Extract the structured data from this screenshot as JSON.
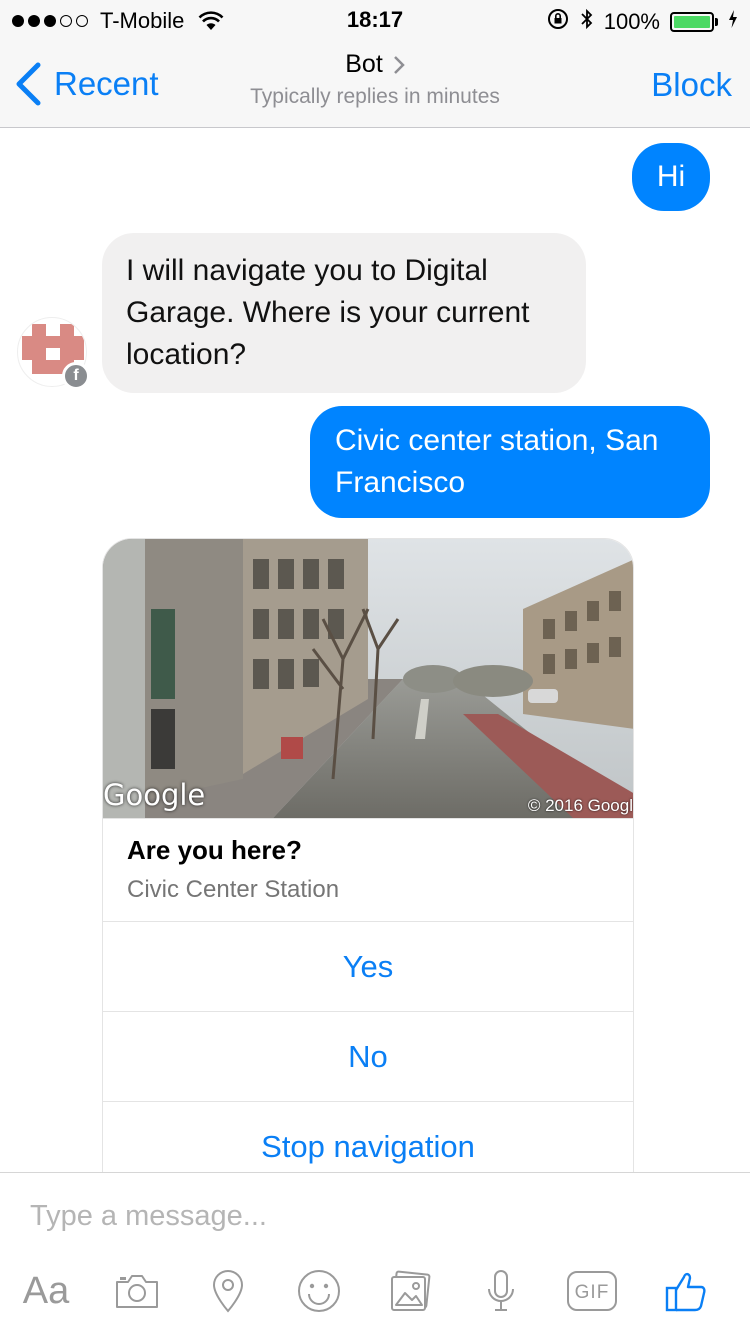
{
  "status_bar": {
    "carrier": "T-Mobile",
    "time": "18:17",
    "battery": "100%"
  },
  "nav": {
    "back_label": "Recent",
    "title": "Bot",
    "subtitle": "Typically replies in minutes",
    "block_label": "Block"
  },
  "messages": [
    {
      "from": "user",
      "text": "Hi"
    },
    {
      "from": "bot",
      "text": "I will navigate you to Digital Garage. Where is your current location?"
    },
    {
      "from": "user",
      "text": "Civic center station, San Francisco"
    }
  ],
  "card": {
    "image_logo": "Google",
    "image_copyright": "© 2016 Googl",
    "title": "Are you here?",
    "subtitle": "Civic Center Station",
    "buttons": [
      "Yes",
      "No",
      "Stop navigation"
    ]
  },
  "composer": {
    "placeholder": "Type a message...",
    "aa_label": "Aa",
    "icons": [
      "camera-icon",
      "location-pin-icon",
      "smiley-icon",
      "photo-gallery-icon",
      "microphone-icon",
      "gif-icon",
      "thumbs-up-icon"
    ]
  },
  "colors": {
    "accent": "#0a7ff5",
    "outgoing_bubble": "#0084ff",
    "incoming_bubble": "#f1f0f0"
  }
}
